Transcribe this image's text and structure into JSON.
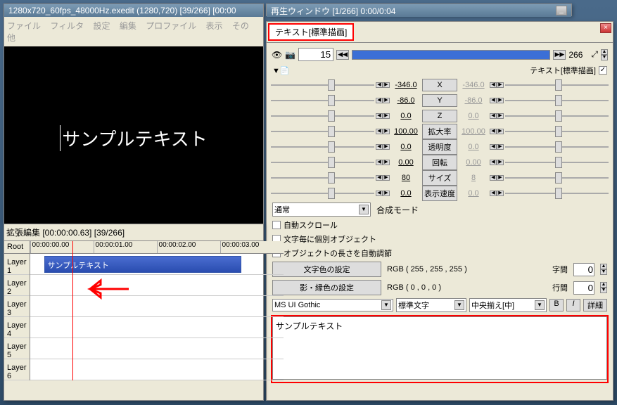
{
  "main": {
    "title": "1280x720_60fps_48000Hz.exedit  (1280,720)  [39/266]  [00:00",
    "menu": [
      "ファイル",
      "フィルタ",
      "設定",
      "編集",
      "プロファイル",
      "表示",
      "その他"
    ],
    "preview_text": "サンプルテキスト"
  },
  "playback": {
    "title": "再生ウィンドウ  [1/266]  0:00/0:04"
  },
  "props": {
    "tab_label": "テキスト[標準描画]",
    "frame_current": "15",
    "frame_total": "266",
    "type_label": "テキスト[標準描画]",
    "params": [
      {
        "name": "X",
        "valL": "-346.0",
        "valR": "-346.0"
      },
      {
        "name": "Y",
        "valL": "-86.0",
        "valR": "-86.0"
      },
      {
        "name": "Z",
        "valL": "0.0",
        "valR": "0.0"
      },
      {
        "name": "拡大率",
        "valL": "100.00",
        "valR": "100.00"
      },
      {
        "name": "透明度",
        "valL": "0.0",
        "valR": "0.0"
      },
      {
        "name": "回転",
        "valL": "0.00",
        "valR": "0.00"
      },
      {
        "name": "サイズ",
        "valL": "80",
        "valR": "8"
      },
      {
        "name": "表示速度",
        "valL": "0.0",
        "valR": "0.0"
      }
    ],
    "blend_label": "合成モード",
    "blend_value": "通常",
    "check1": "自動スクロール",
    "check2": "文字毎に個別オブジェクト",
    "check3": "オブジェクトの長さを自動調節",
    "text_color_btn": "文字色の設定",
    "text_color_val": "RGB ( 255 , 255 , 255 )",
    "shadow_color_btn": "影・縁色の設定",
    "shadow_color_val": "RGB ( 0 , 0 , 0 )",
    "char_spacing_label": "字間",
    "char_spacing_val": "0",
    "line_spacing_label": "行間",
    "line_spacing_val": "0",
    "font": "MS UI Gothic",
    "style": "標準文字",
    "align": "中央揃え[中]",
    "bold": "B",
    "italic": "I",
    "detail": "詳細",
    "text_content": "サンプルテキスト"
  },
  "timeline": {
    "title": "拡張編集 [00:00:00.63] [39/266]",
    "root": "Root",
    "layers": [
      "Layer 1",
      "Layer 2",
      "Layer 3",
      "Layer 4",
      "Layer 5",
      "Layer 6"
    ],
    "times": [
      "00:00:00.00",
      "00:00:01.00",
      "00:00:02.00",
      "00:00:03.00"
    ],
    "clip_label": "サンプルテキスト"
  }
}
